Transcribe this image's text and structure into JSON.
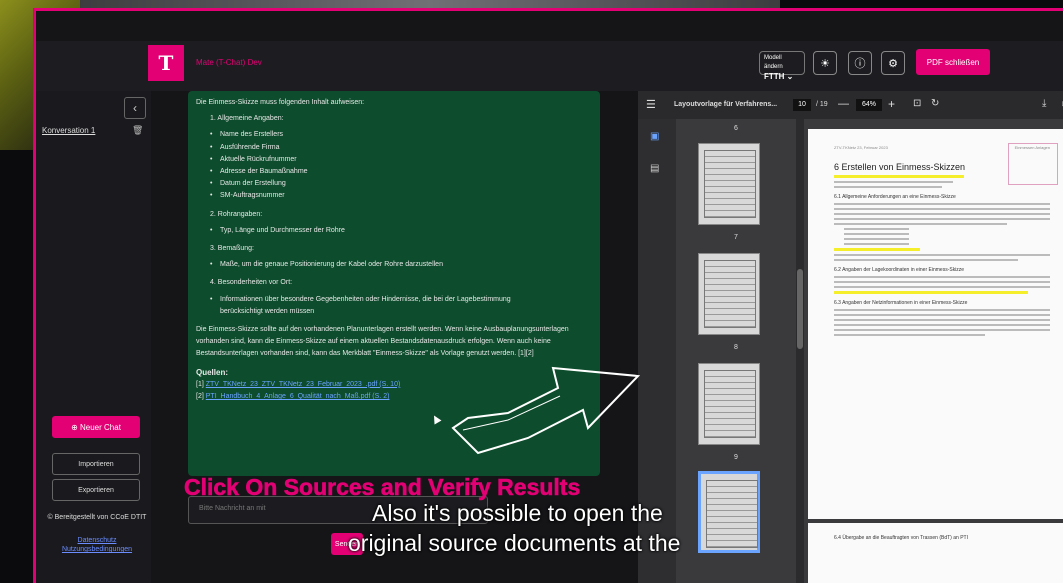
{
  "app": {
    "title": "Mate (T-Chat) Dev",
    "logo": "T"
  },
  "header": {
    "model_label": "Modell ändern",
    "model_value": "FTTH",
    "pdf_close_label": "PDF schließen",
    "accent_color": "#e20074"
  },
  "sidebar": {
    "collapse_icon": "‹",
    "conversation": "Konversation 1",
    "new_chat": "Neuer Chat",
    "import": "Importieren",
    "export": "Exportieren",
    "copyright": "© Bereitgestellt von CCoE DTIT",
    "privacy": "Datenschutz",
    "terms": "Nutzungsbedingungen"
  },
  "chat": {
    "intro": "Die Einmess-Skizze muss folgenden Inhalt aufweisen:",
    "s1": "1. Allgemeine Angaben:",
    "s1_items": [
      "Name des Erstellers",
      "Ausführende Firma",
      "Aktuelle Rückrufnummer",
      "Adresse der Baumaßnahme",
      "Datum der Erstellung",
      "SM-Auftragsnummer"
    ],
    "s2": "2. Rohrangaben:",
    "s2_item": "Typ, Länge und Durchmesser der Rohre",
    "s3": "3. Bemaßung:",
    "s3_item": "Maße, um die genaue Positionierung der Kabel oder Rohre darzustellen",
    "s4": "4. Besonderheiten vor Ort:",
    "s4_item": "Informationen über besondere Gegebenheiten oder Hindernisse, die bei der Lagebestimmung berücksichtigt werden müssen",
    "paragraph": "Die Einmess-Skizze sollte auf den vorhandenen Planunterlagen erstellt werden. Wenn keine Ausbauplanungsunterlagen vorhanden sind, kann die Einmess-Skizze auf einem aktuellen Bestandsdatenausdruck erfolgen. Wenn auch keine Bestandsunterlagen vorhanden sind, kann das Merkblatt \"Einmess-Skizze\" als Vorlage genutzt werden. [1][2]",
    "sources_title": "Quellen:",
    "source1_num": "[1]",
    "source1": "ZTV_TKNetz_23_ZTV_TKNetz_23_Februar_2023_.pdf (S. 10)",
    "source2_num": "[2]",
    "source2": "PTI_Handbuch_4_Anlage_6_Qualität_nach_Maß.pdf (S. 2)",
    "input_placeholder": "Bitte Nachricht an mit",
    "send": "Senden"
  },
  "viewer": {
    "title": "Layoutvorlage für Verfahrens...",
    "page_current": "10",
    "page_total": "/ 19",
    "zoom": "64%",
    "thumb_pages": [
      "6",
      "7",
      "8",
      "9"
    ],
    "doc_header_left": "ZTV-TKNetz 23, Februar 2023",
    "doc_header_right": "Einmessen Anlagen",
    "doc_heading": "6     Erstellen von Einmess-Skizzen",
    "doc_sub1": "6.1     Allgemeine Anforderungen an eine Einmess-Skizze",
    "doc_sub2": "6.2     Angaben der Lagekoordinaten in einer Einmess-Skizze",
    "doc_sub3": "6.3     Angaben der Netzinformationen in einer Einmess-Skizze",
    "doc_sub4": "6.4     Übergabe an die Beauftragten von Trassen (BdT) an PTI"
  },
  "overlay": {
    "caption": "Click On Sources and Verify Results",
    "subtitle1": "Also it's possible to open the",
    "subtitle2": "original source documents at the"
  }
}
